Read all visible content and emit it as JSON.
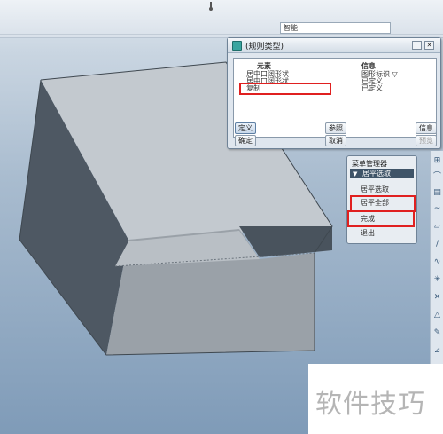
{
  "topbar": {
    "search_value": "智能"
  },
  "dialog": {
    "title": "(规则类型)",
    "close_symbol": "✕",
    "columns": [
      "元素",
      "信息"
    ],
    "rows": [
      {
        "element": "居中口阔形状",
        "info": "图形标识 ▽"
      },
      {
        "element": "居中口阔形状",
        "info": "已定义"
      },
      {
        "element": "复制",
        "info": "已定义"
      }
    ],
    "buttons": {
      "define": "定义",
      "reference": "参照",
      "info": "信息",
      "confirm": "确定",
      "cancel": "取消",
      "preview": "预览"
    }
  },
  "menu": {
    "title": "菜单管理器",
    "section": "居平选取",
    "section_arrow": "▼",
    "items": [
      "居平选取",
      "居平全部",
      "完成",
      "退出"
    ]
  },
  "watermark": {
    "text": "软件技巧"
  },
  "colors": {
    "highlight": "#e02020",
    "menu_header": "#3f5468"
  }
}
